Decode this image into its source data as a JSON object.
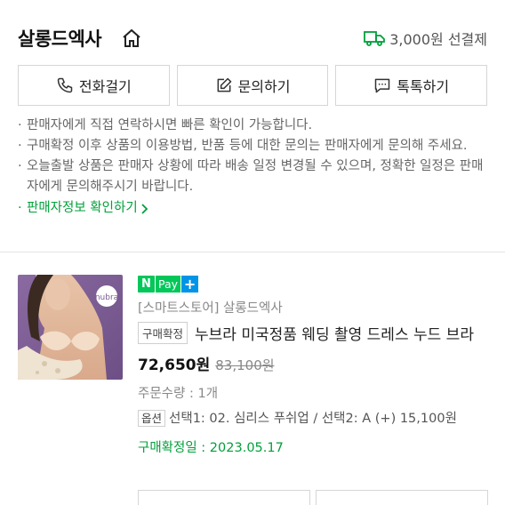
{
  "header": {
    "seller_name": "살롱드엑사",
    "shipping_text": "3,000원 선결제"
  },
  "actions": {
    "call": "전화걸기",
    "inquiry": "문의하기",
    "talk": "톡톡하기"
  },
  "notices": [
    "판매자에게 직접 연락하시면 빠른 확인이 가능합니다.",
    "구매확정 이후 상품의 이용방법, 반품 등에 대한 문의는 판매자에게 문의해 주세요.",
    "오늘출발 상품은 판매자 상황에 따라 배송 일정 변경될 수 있으며, 정확한 일정은 판매자에게 문의해주시기 바랍니다."
  ],
  "seller_info_link": "판매자정보 확인하기",
  "order": {
    "npay_n": "N",
    "npay_pay": "Pay",
    "npay_plus": "+",
    "thumb_logo": "nubra",
    "store": "[스마트스토어] 살롱드엑사",
    "status_tag": "구매확정",
    "product_name": "누브라 미국정품 웨딩 촬영 드레스 누드 브라",
    "price": "72,650원",
    "original_price": "83,100원",
    "quantity": "주문수량 : 1개",
    "option_tag": "옵션",
    "option_text": "선택1: 02. 심리스 푸쉬업 / 선택2: A (+) 15,100원",
    "confirm_date": "구매확정일 : 2023.05.17"
  },
  "colors": {
    "green": "#00a03a",
    "npay_green": "#03c75a",
    "npay_blue": "#0094e8"
  }
}
